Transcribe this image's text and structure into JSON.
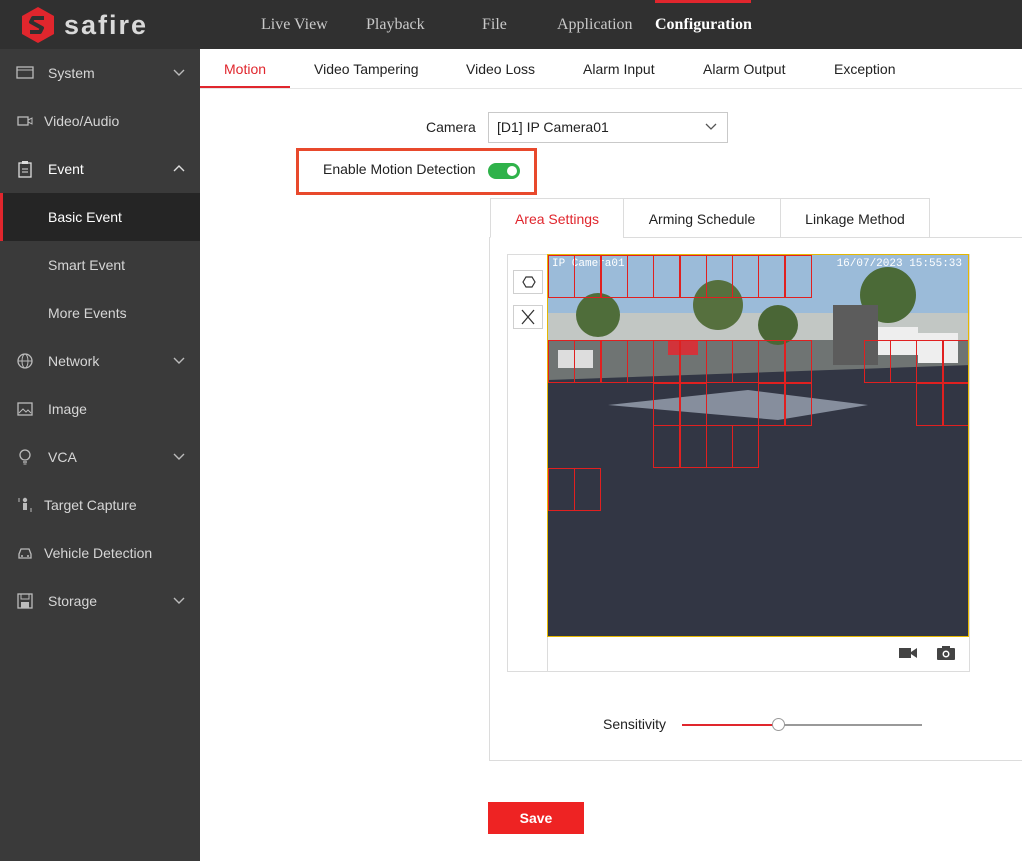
{
  "brand": {
    "name": "safire",
    "accent": "#e0262d"
  },
  "topnav": {
    "items": [
      "Live View",
      "Playback",
      "File",
      "Application",
      "Configuration"
    ],
    "active": "Configuration"
  },
  "sidebar": {
    "items": [
      {
        "label": "System",
        "icon": "monitor-icon",
        "expandable": true
      },
      {
        "label": "Video/Audio",
        "icon": "video-camera-icon",
        "expandable": false
      },
      {
        "label": "Event",
        "icon": "clipboard-icon",
        "expandable": true,
        "expanded": true
      },
      {
        "label": "Basic Event",
        "sub": true,
        "selected": true
      },
      {
        "label": "Smart Event",
        "sub": true
      },
      {
        "label": "More Events",
        "sub": true
      },
      {
        "label": "Network",
        "icon": "globe-icon",
        "expandable": true
      },
      {
        "label": "Image",
        "icon": "image-icon",
        "expandable": false
      },
      {
        "label": "VCA",
        "icon": "bulb-icon",
        "expandable": true
      },
      {
        "label": "Target Capture",
        "icon": "person-icon",
        "expandable": false
      },
      {
        "label": "Vehicle Detection",
        "icon": "car-icon",
        "expandable": false
      },
      {
        "label": "Storage",
        "icon": "floppy-icon",
        "expandable": true
      }
    ]
  },
  "subtabs": {
    "items": [
      "Motion",
      "Video Tampering",
      "Video Loss",
      "Alarm Input",
      "Alarm Output",
      "Exception"
    ],
    "active": "Motion"
  },
  "form": {
    "camera_label": "Camera",
    "camera_value": "[D1] IP Camera01",
    "enable_label": "Enable Motion Detection",
    "enable_value": true
  },
  "inner_tabs": {
    "items": [
      "Area Settings",
      "Arming Schedule",
      "Linkage Method"
    ],
    "active": "Area Settings"
  },
  "video": {
    "osd_name": "IP Camera01",
    "osd_time": "16/07/2023 15:55:33",
    "tools": [
      "draw-area-icon",
      "clear-icon"
    ],
    "actions": [
      "record-icon",
      "snapshot-icon"
    ]
  },
  "sensitivity": {
    "label": "Sensitivity",
    "value": 0.4
  },
  "save_label": "Save"
}
